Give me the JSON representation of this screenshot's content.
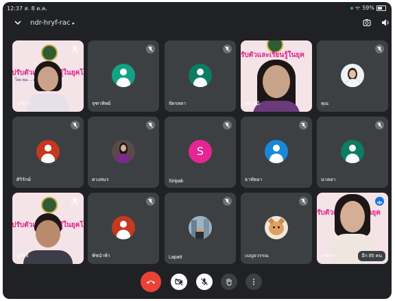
{
  "status": {
    "time": "12:37",
    "date": "ส. 8 ต.ค.",
    "battery": "59%"
  },
  "header": {
    "meeting_code": "ndr-hryf-rac",
    "caret": "▸",
    "down": "⌄"
  },
  "tiles": [
    {
      "name": "นวัตรา",
      "kind": "video"
    },
    {
      "name": "จุฑาทิพย์",
      "kind": "avatar",
      "color": "#12a386"
    },
    {
      "name": "จัดรลตา",
      "kind": "avatar",
      "color": "#0c7c62"
    },
    {
      "name": "สุธาลินี",
      "kind": "video"
    },
    {
      "name": "คุณ",
      "kind": "photo"
    },
    {
      "name": "ศิริรักษ์",
      "kind": "avatar",
      "color": "#c5391e"
    },
    {
      "name": "ดวงสมร",
      "kind": "photo"
    },
    {
      "name": "Siripak",
      "kind": "letter",
      "letter": "S",
      "color": "#e52592"
    },
    {
      "name": "ธาทัตยา",
      "kind": "avatar",
      "color": "#1a88d8"
    },
    {
      "name": "นาคยา",
      "kind": "avatar",
      "color": "#0c7c62"
    },
    {
      "name": "ภูสิทธิ์",
      "kind": "video"
    },
    {
      "name": "พัชนำพ้า",
      "kind": "avatar",
      "color": "#c5391e"
    },
    {
      "name": "Lapatt",
      "kind": "photo"
    },
    {
      "name": "เบญจวรรณ",
      "kind": "photo"
    },
    {
      "name": "หรัตรา",
      "kind": "video"
    }
  ],
  "poster": {
    "banner": "การปรับตัวและเรียนรู้ในยุคโควิด",
    "banner_short": "รับตัวและเรียนรู้ในยุค",
    "sub": "โดย คุณ ... อาจารย์ผู้อธิการบดี"
  },
  "overflow_badge": "อีก 85 คน",
  "colors": {
    "background": "#202124",
    "tile": "#3c4043",
    "end_call": "#ea4335",
    "accent": "#1a73e8"
  }
}
